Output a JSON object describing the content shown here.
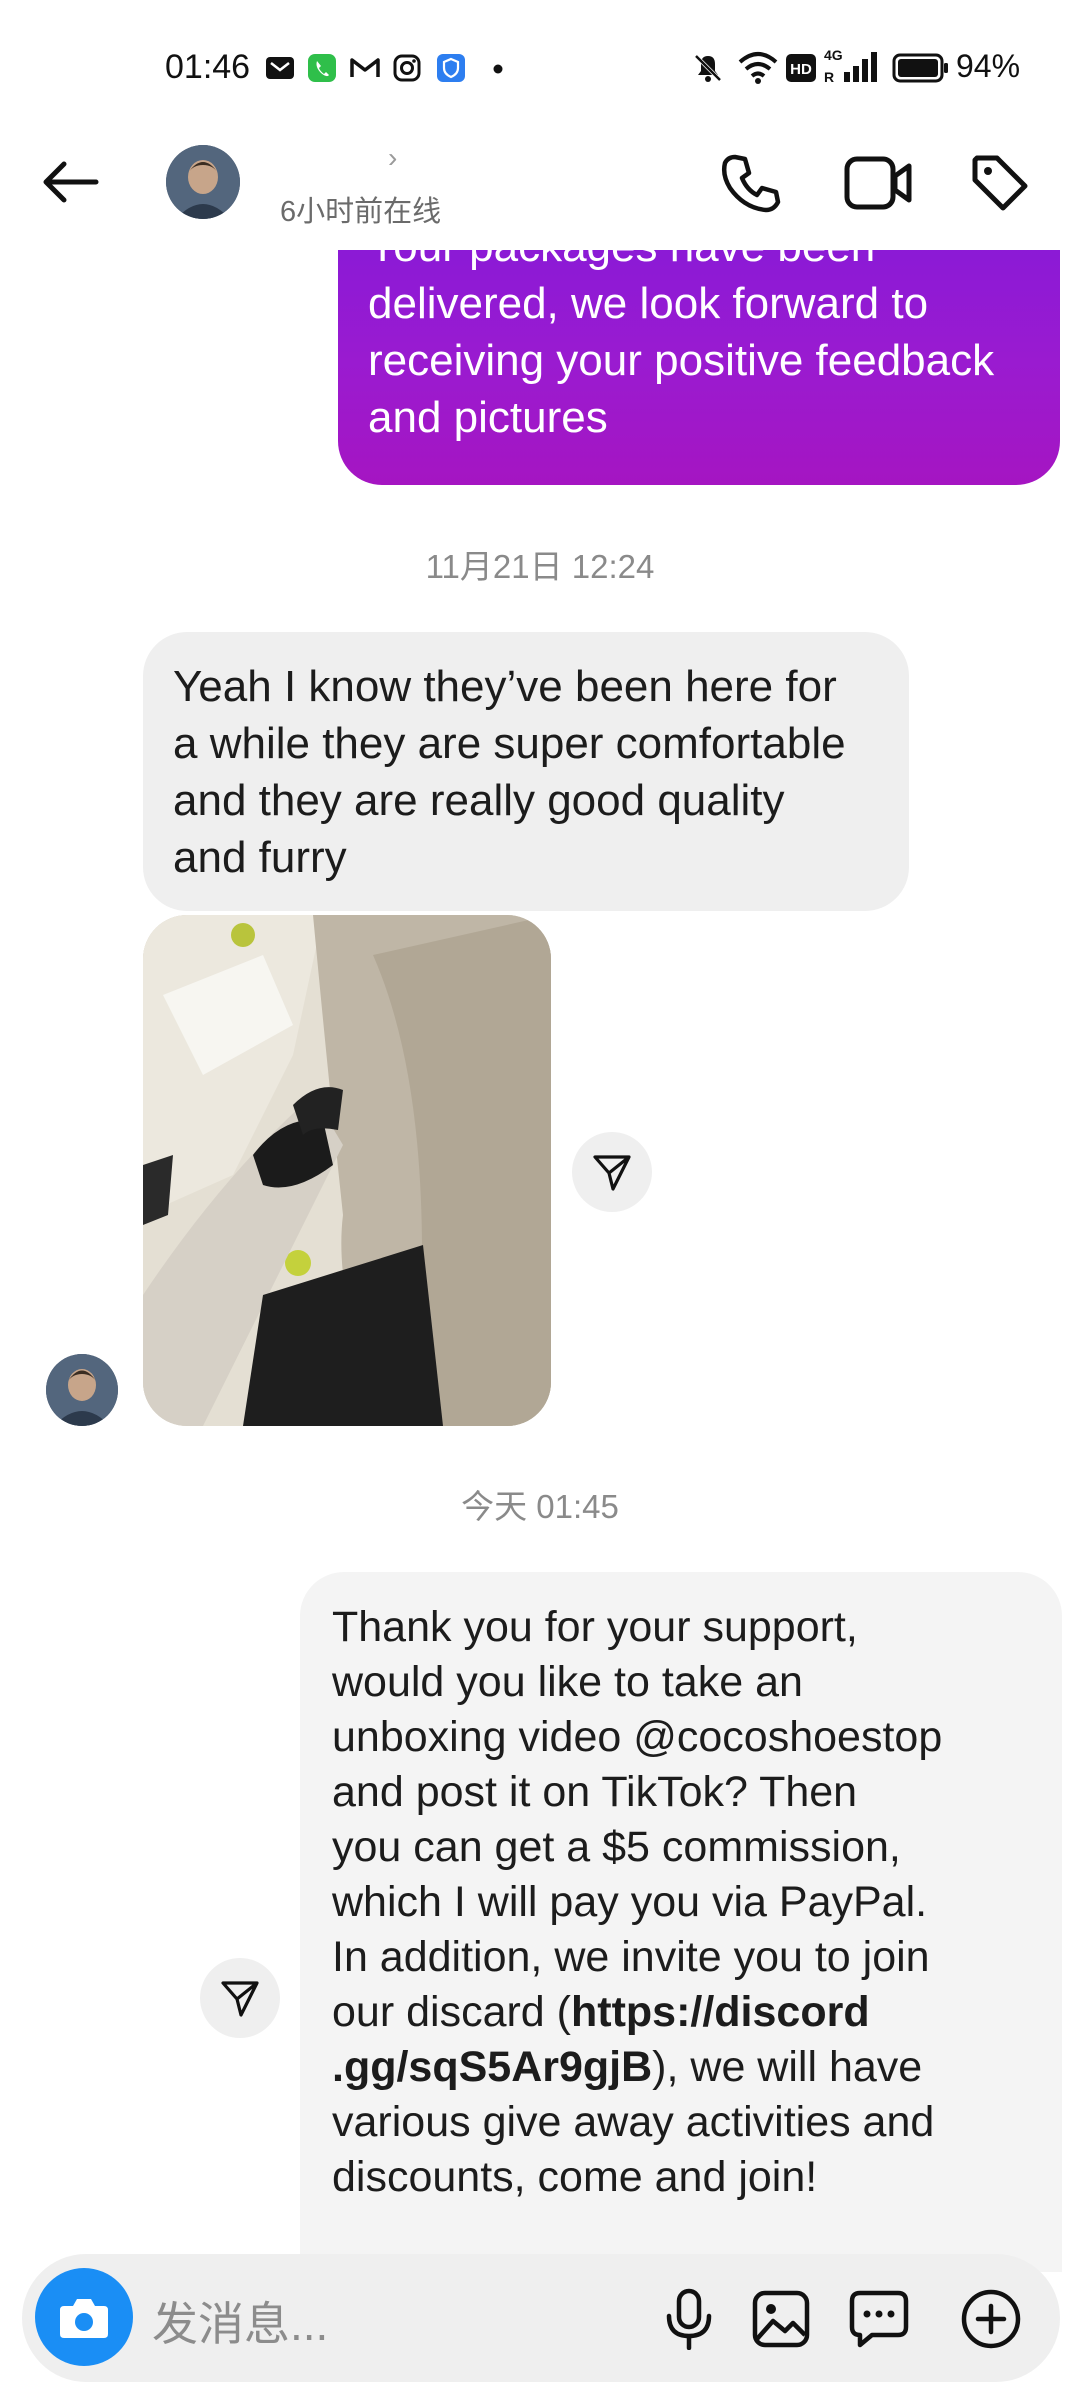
{
  "status_bar": {
    "time": "01:46",
    "battery": "94%",
    "icons": [
      "mail-icon",
      "phone-icon",
      "gmail-icon",
      "instagram-icon",
      "shield-icon",
      "dot-icon",
      "mute-icon",
      "wifi-icon",
      "hd-icon",
      "signal-4g-icon",
      "battery-icon"
    ]
  },
  "header": {
    "presence": "6小时前在线",
    "chevron": "›"
  },
  "messages": {
    "m1": {
      "lines": [
        "Your packages have been",
        "delivered, we look forward to",
        "receiving your positive feedback",
        "and pictures"
      ]
    },
    "ts1": "11月21日 12:24",
    "m2": {
      "lines": [
        "Yeah I know they’ve been here for",
        "a while they are super comfortable",
        "and they are really good quality",
        "and furry"
      ]
    },
    "ts2": "今天 01:45",
    "m3": {
      "lines": [
        "Thank you for your support,",
        "would you like to take an",
        "unboxing video @cocoshoestop",
        "and post it on TikTok? Then",
        "you can get a $5 commission,",
        "which I will pay you via PayPal.",
        "In addition, we invite you to join"
      ],
      "line8_pre": "our discard (",
      "link_a": "https://discord",
      "link_b": ".gg/sqS5Ar9gjB",
      "line9_post": "), we will have",
      "lines_end": [
        "various give away activities and",
        "discounts, come and join!"
      ]
    }
  },
  "composer": {
    "placeholder": "发消息..."
  },
  "colors": {
    "accent": "#1a8ef5",
    "sent_bubble": "#9a1bd0"
  }
}
